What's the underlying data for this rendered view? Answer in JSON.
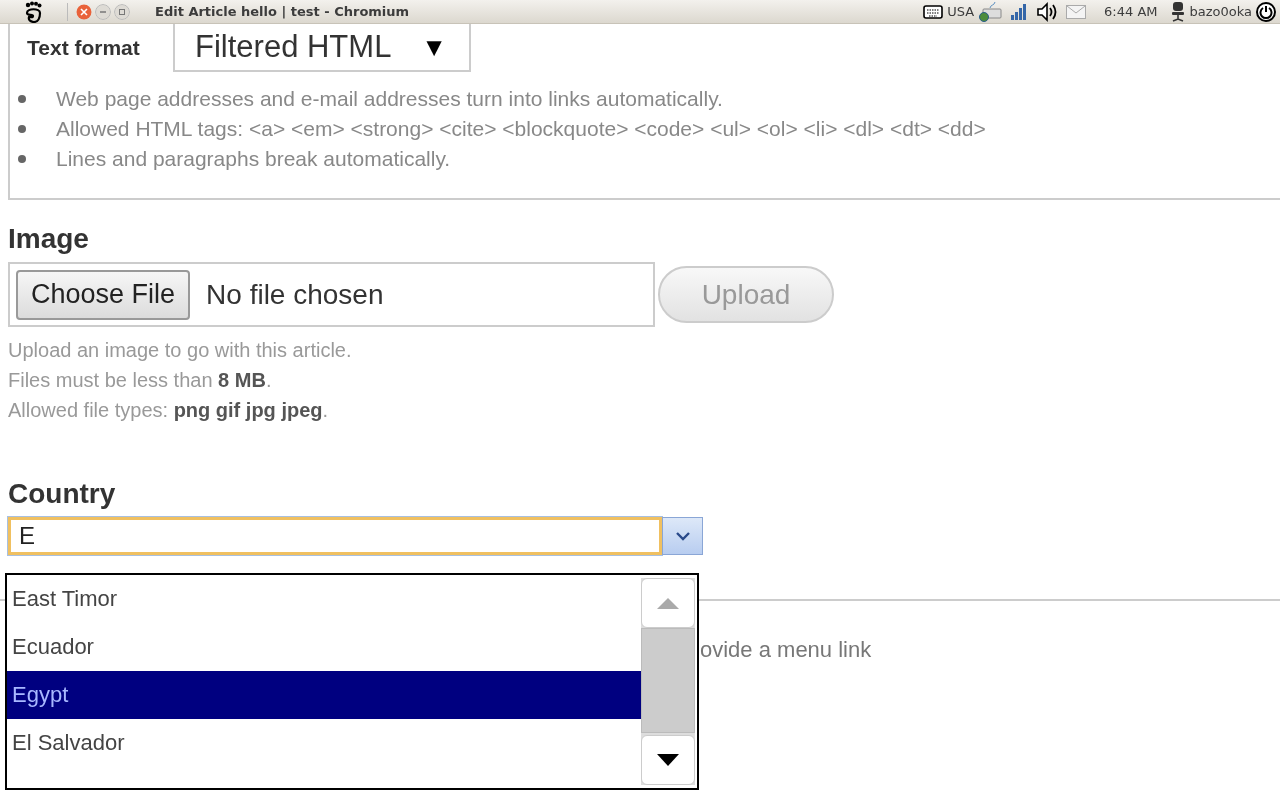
{
  "top_bar": {
    "title": "Edit Article hello | test - Chromium",
    "keyboard_layout": "USA",
    "time": "6:44 AM",
    "user": "bazo0oka"
  },
  "text_format": {
    "label": "Text format",
    "value": "Filtered HTML",
    "arrow": "▼",
    "tips": [
      "Web page addresses and e-mail addresses turn into links automatically.",
      "Allowed HTML tags: <a> <em> <strong> <cite> <blockquote> <code> <ul> <ol> <li> <dl> <dt> <dd>",
      "Lines and paragraphs break automatically."
    ]
  },
  "image": {
    "label": "Image",
    "choose_button": "Choose File",
    "file_status": "No file chosen",
    "upload_button": "Upload",
    "upload_disabled": true,
    "help": [
      "Upload an image to go with this article.",
      "Files must be less than **8 MB**.",
      "Allowed file types: **png gif jpg jpeg**."
    ]
  },
  "country": {
    "label": "Country",
    "value": "E",
    "options": [
      {
        "label": "East Timor",
        "selected": false
      },
      {
        "label": "Ecuador",
        "selected": false
      },
      {
        "label": "Egypt",
        "selected": true
      },
      {
        "label": "El Salvador",
        "selected": false
      }
    ]
  },
  "partial_text": "ovide a menu link"
}
